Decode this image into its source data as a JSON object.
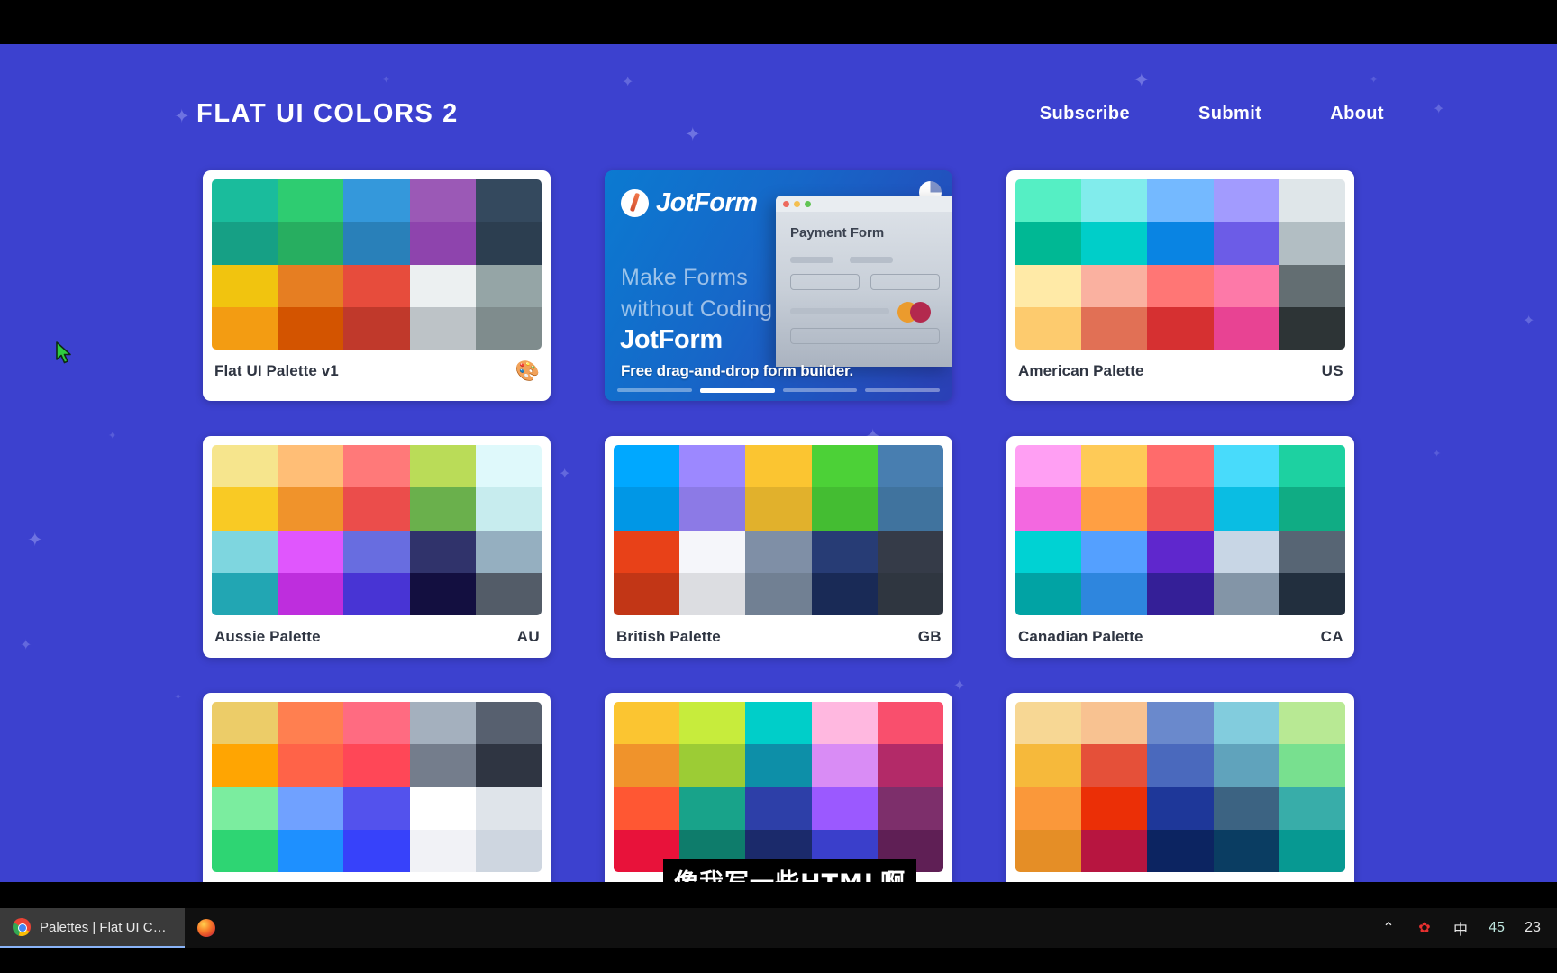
{
  "header": {
    "brand": "FLAT UI COLORS 2",
    "nav": [
      {
        "label": "Subscribe"
      },
      {
        "label": "Submit"
      },
      {
        "label": "About"
      }
    ]
  },
  "ad": {
    "logo_text": "JotForm",
    "headline_line1": "Make Forms",
    "headline_line2": "without Coding",
    "brand": "JotForm",
    "subtext": "Free drag-and-drop form builder.",
    "mock_title": "Payment Form",
    "pager_active_index": 1,
    "pager_count": 4
  },
  "cards": [
    {
      "title": "Flat UI Palette v1",
      "badge": "🎨",
      "badge_kind": "emoji",
      "colors": [
        "#1abc9c",
        "#2ecc71",
        "#3498db",
        "#9b59b6",
        "#34495e",
        "#16a085",
        "#27ae60",
        "#2980b9",
        "#8e44ad",
        "#2c3e50",
        "#f1c40f",
        "#e67e22",
        "#e74c3c",
        "#ecf0f1",
        "#95a5a6",
        "#f39c12",
        "#d35400",
        "#c0392b",
        "#bdc3c7",
        "#7f8c8d"
      ]
    },
    {
      "title": "American Palette",
      "badge": "US",
      "badge_kind": "text",
      "colors": [
        "#55efc4",
        "#81ecec",
        "#74b9ff",
        "#a29bfe",
        "#dfe6e9",
        "#00b894",
        "#00cec9",
        "#0984e3",
        "#6c5ce7",
        "#b2bec3",
        "#ffeaa7",
        "#fab1a0",
        "#ff7675",
        "#fd79a8",
        "#636e72",
        "#fdcb6e",
        "#e17055",
        "#d63031",
        "#e84393",
        "#2d3436"
      ]
    },
    {
      "title": "Aussie Palette",
      "badge": "AU",
      "badge_kind": "text",
      "colors": [
        "#f6e58d",
        "#ffbe76",
        "#ff7979",
        "#badc58",
        "#dff9fb",
        "#f9ca24",
        "#f0932b",
        "#eb4d4b",
        "#6ab04c",
        "#c7ecee",
        "#7ed6df",
        "#e056fd",
        "#686de0",
        "#30336b",
        "#95afc0",
        "#22a6b3",
        "#be2edd",
        "#4834d4",
        "#130f40",
        "#535c68"
      ]
    },
    {
      "title": "British Palette",
      "badge": "GB",
      "badge_kind": "text",
      "colors": [
        "#00a8ff",
        "#9c88ff",
        "#fbc531",
        "#4cd137",
        "#487eb0",
        "#0097e6",
        "#8c7ae6",
        "#e1b12c",
        "#44bd32",
        "#40739e",
        "#e84118",
        "#f5f6fa",
        "#7f8fa6",
        "#273c75",
        "#353b48",
        "#c23616",
        "#dcdde1",
        "#718093",
        "#192a56",
        "#2f3640"
      ]
    },
    {
      "title": "Canadian Palette",
      "badge": "CA",
      "badge_kind": "text",
      "colors": [
        "#ff9ff3",
        "#feca57",
        "#ff6b6b",
        "#48dbfb",
        "#1dd1a1",
        "#f368e0",
        "#ff9f43",
        "#ee5253",
        "#0abde3",
        "#10ac84",
        "#00d2d3",
        "#54a0ff",
        "#5f27cd",
        "#c8d6e5",
        "#576574",
        "#01a3a4",
        "#2e86de",
        "#341f97",
        "#8395a7",
        "#222f3e"
      ]
    },
    {
      "title": "",
      "badge": "",
      "badge_kind": "none",
      "colors": [
        "#eccc68",
        "#ff7f50",
        "#ff6b81",
        "#a4b0be",
        "#57606f",
        "#ffa502",
        "#ff6348",
        "#ff4757",
        "#747d8c",
        "#2f3542",
        "#7bed9f",
        "#70a1ff",
        "#5352ed",
        "#ffffff",
        "#dfe4ea",
        "#2ed573",
        "#1e90ff",
        "#3742fa",
        "#f1f2f6",
        "#ced6e0"
      ]
    },
    {
      "title": "",
      "badge": "",
      "badge_kind": "none",
      "colors": [
        "#fbc531",
        "#c7ec3c",
        "#00cec9",
        "#ffb8e0",
        "#f94f6d",
        "#f0932b",
        "#9ccc35",
        "#0d8fa8",
        "#d98cf5",
        "#b32a68",
        "#ff5733",
        "#18a38a",
        "#2d3fa8",
        "#9b59ff",
        "#7d2f6b",
        "#e8123a",
        "#0e7c6b",
        "#1b2a6b",
        "#3a3fcb",
        "#5f1f55"
      ]
    },
    {
      "title": "",
      "badge": "",
      "badge_kind": "none",
      "colors": [
        "#f7d794",
        "#f8c291",
        "#6a89cc",
        "#82ccdd",
        "#b8e994",
        "#f6b93b",
        "#e55039",
        "#4a69bd",
        "#60a3bc",
        "#78e08f",
        "#fa983a",
        "#eb2f06",
        "#1e3799",
        "#3c6382",
        "#38ada9",
        "#e58e26",
        "#b71540",
        "#0c2461",
        "#0a3d62",
        "#079992"
      ]
    }
  ],
  "subtitle": "像我写一些HTML啊",
  "taskbar": {
    "items": [
      {
        "label": "Palettes | Flat UI Col...",
        "icon": "chrome-icon",
        "active": true
      },
      {
        "label": "",
        "icon": "firefox-icon",
        "active": false
      }
    ],
    "tray": [
      {
        "label": "⌃",
        "name": "show-hidden-icons-icon"
      },
      {
        "label": "✿",
        "name": "tray-flower-icon"
      },
      {
        "label": "中",
        "name": "ime-mode-icon"
      },
      {
        "label": "45",
        "name": "tray-badge-45"
      },
      {
        "label": "23",
        "name": "tray-clock"
      }
    ]
  },
  "theme": {
    "background": "#3c41cf",
    "card_background": "#ffffff",
    "text_light": "#ffffff",
    "text_dark": "#2f3542"
  }
}
